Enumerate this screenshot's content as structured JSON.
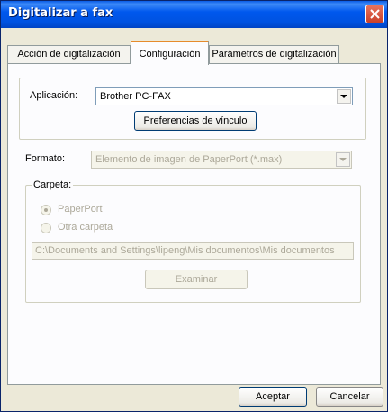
{
  "window": {
    "title": "Digitalizar a fax"
  },
  "tabs": [
    {
      "label": "Acción de digitalización"
    },
    {
      "label": "Configuración"
    },
    {
      "label": "Parámetros de digitalización"
    }
  ],
  "application": {
    "label": "Aplicación:",
    "value": "Brother PC-FAX",
    "link_prefs_button": "Preferencias de vínculo"
  },
  "format": {
    "label": "Formato:",
    "value": "Elemento de imagen de PaperPort (*.max)"
  },
  "folder": {
    "legend": "Carpeta:",
    "option_paperport": "PaperPort",
    "option_other": "Otra carpeta",
    "selected": "PaperPort",
    "path": "C:\\Documents and Settings\\lipeng\\Mis documentos\\Mis documentos",
    "browse_button": "Examinar"
  },
  "footer": {
    "accept_button": "Aceptar",
    "cancel_button": "Cancelar"
  },
  "colors": {
    "titlebar": "#0058ee",
    "accent_tab": "#e68b2c",
    "close": "#c9402a"
  }
}
